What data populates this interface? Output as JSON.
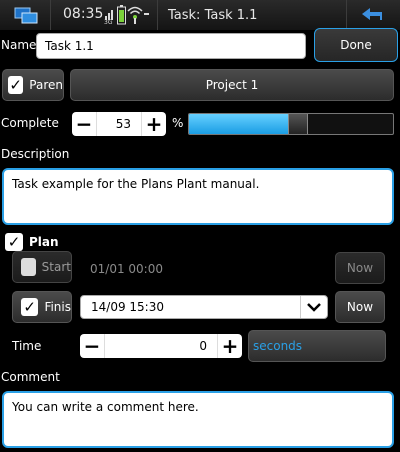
{
  "status": {
    "time": "08:35",
    "network": "3G",
    "title": "Task: Task 1.1"
  },
  "form": {
    "name_label": "Name",
    "name_value": "Task 1.1",
    "done_label": "Done",
    "parent_check_label": "Paren",
    "parent_checked": true,
    "parent_project": "Project 1",
    "complete_label": "Complete",
    "complete_value": "53",
    "complete_unit": "%",
    "complete_progress": 0.53,
    "description_label": "Description",
    "description_value": "Task example for the Plans Plant manual.",
    "plan_label": "Plan",
    "plan_checked": true,
    "start_label": "Start",
    "start_checked": false,
    "start_value": "01/01 00:00",
    "start_now": "Now",
    "finish_label": "Finis",
    "finish_checked": true,
    "finish_value": "14/09 15:30",
    "finish_now": "Now",
    "time_label": "Time",
    "time_value": "0",
    "time_unit": "seconds",
    "comment_label": "Comment",
    "comment_value": "You can write a comment here."
  },
  "colors": {
    "accent": "#2aa0e6",
    "progress": "#2bb0ee"
  }
}
